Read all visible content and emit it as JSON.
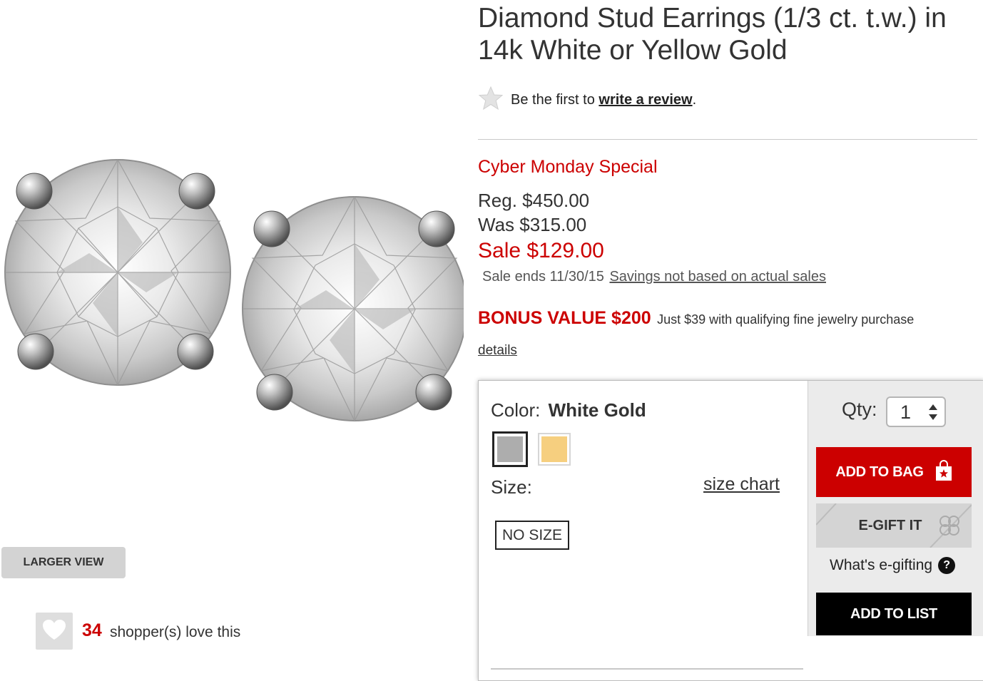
{
  "product": {
    "title": "Diamond Stud Earrings (1/3 ct. t.w.) in 14k White or Yellow Gold"
  },
  "rating": {
    "prefix": "Be the first to ",
    "link": "write a review",
    "suffix": ".",
    "icon": "star-icon"
  },
  "pricing": {
    "promo_name": "Cyber Monday Special",
    "regular": "Reg. $450.00",
    "was": "Was $315.00",
    "sale": "Sale $129.00",
    "sale_ends": "Sale ends 11/30/15",
    "savings_link": "Savings not based on actual sales"
  },
  "bonus": {
    "label": "BONUS VALUE $200",
    "description": "Just $39 with qualifying fine jewelry purchase",
    "details_link": "details"
  },
  "gallery": {
    "larger_view": "LARGER VIEW"
  },
  "love": {
    "count": "34",
    "text": "shopper(s) love this",
    "icon": "heart-icon"
  },
  "options": {
    "color_label": "Color:",
    "color_value": "White Gold",
    "swatches": [
      {
        "name": "White Gold",
        "color": "#adadad",
        "selected": true
      },
      {
        "name": "Yellow Gold",
        "color": "#f6cf7f",
        "selected": false
      }
    ],
    "size_label": "Size:",
    "size_chart_link": "size chart",
    "size_value": "NO SIZE"
  },
  "actions": {
    "qty_label": "Qty:",
    "qty_value": "1",
    "add_to_bag": "ADD TO BAG",
    "egift": "E-GIFT IT",
    "whats_egifting": "What's e-gifting",
    "help_glyph": "?",
    "add_to_list": "ADD TO LIST"
  },
  "colors": {
    "brand_red": "#cc0000",
    "add_to_list_bg": "#000000",
    "egift_bg": "#d4d4d4"
  }
}
